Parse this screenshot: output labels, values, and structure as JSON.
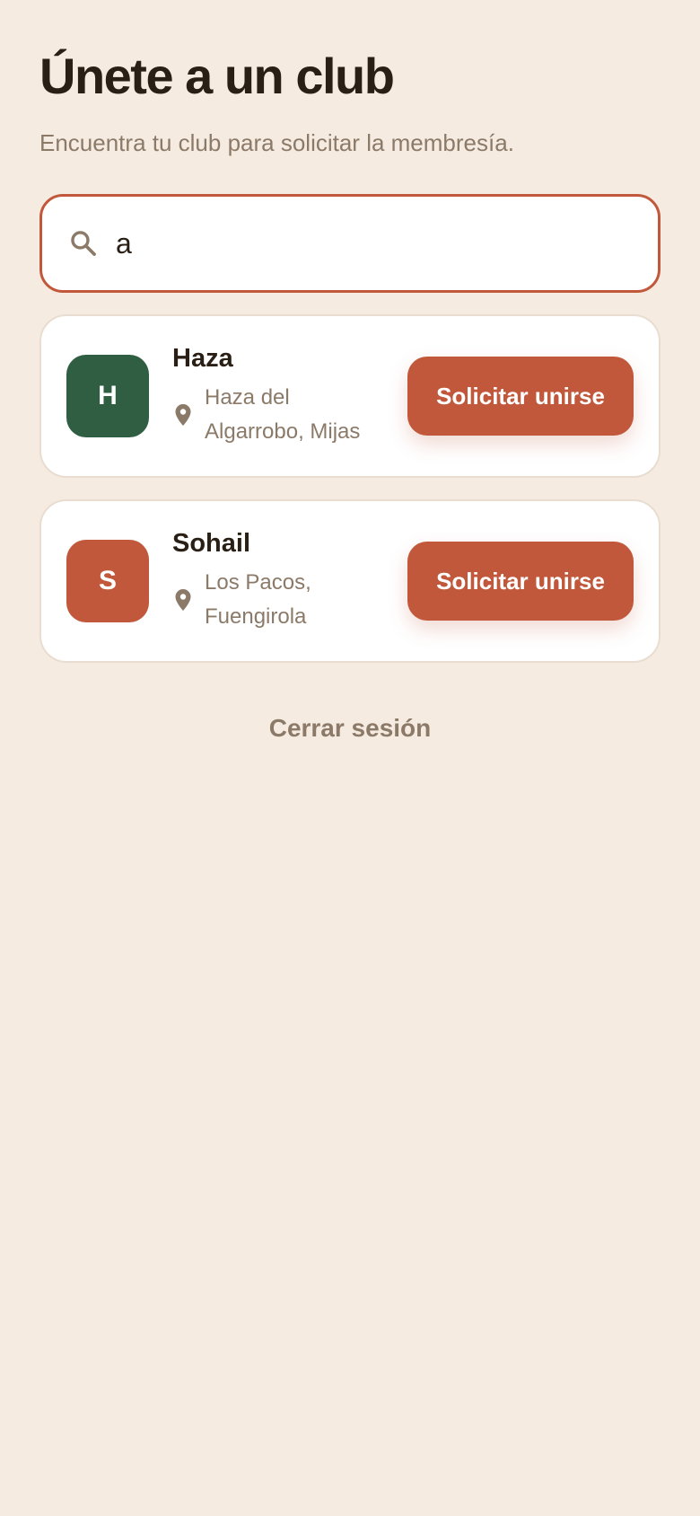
{
  "header": {
    "title": "Únete a un club",
    "subtitle": "Encuentra tu club para solicitar la membresía."
  },
  "search": {
    "value": "a",
    "icon": "search-icon"
  },
  "clubs": [
    {
      "initial": "H",
      "name": "Haza",
      "location": "Haza del Algarrobo, Mijas",
      "avatar_color": "#2F5E43",
      "button_label": "Solicitar unirse"
    },
    {
      "initial": "S",
      "name": "Sohail",
      "location": "Los Pacos, Fuengirola",
      "avatar_color": "#C1583B",
      "button_label": "Solicitar unirse"
    }
  ],
  "footer": {
    "logout_label": "Cerrar sesión"
  },
  "colors": {
    "background": "#F5EBE1",
    "accent": "#C1583B",
    "text_primary": "#2A1F15",
    "text_secondary": "#8C7A69"
  }
}
